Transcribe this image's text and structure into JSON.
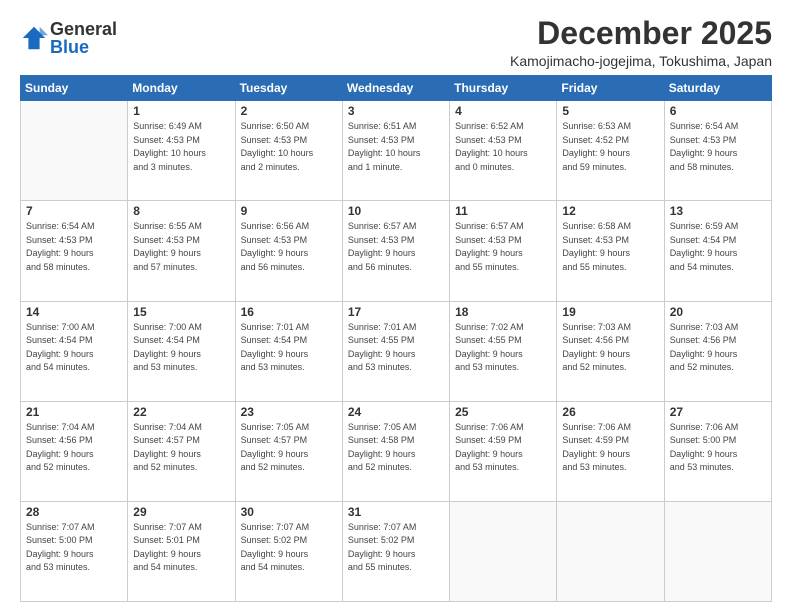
{
  "logo": {
    "line1": "General",
    "line2": "Blue"
  },
  "title": "December 2025",
  "subtitle": "Kamojimacho-jogejima, Tokushima, Japan",
  "days_of_week": [
    "Sunday",
    "Monday",
    "Tuesday",
    "Wednesday",
    "Thursday",
    "Friday",
    "Saturday"
  ],
  "weeks": [
    [
      {
        "day": "",
        "info": ""
      },
      {
        "day": "1",
        "info": "Sunrise: 6:49 AM\nSunset: 4:53 PM\nDaylight: 10 hours\nand 3 minutes."
      },
      {
        "day": "2",
        "info": "Sunrise: 6:50 AM\nSunset: 4:53 PM\nDaylight: 10 hours\nand 2 minutes."
      },
      {
        "day": "3",
        "info": "Sunrise: 6:51 AM\nSunset: 4:53 PM\nDaylight: 10 hours\nand 1 minute."
      },
      {
        "day": "4",
        "info": "Sunrise: 6:52 AM\nSunset: 4:53 PM\nDaylight: 10 hours\nand 0 minutes."
      },
      {
        "day": "5",
        "info": "Sunrise: 6:53 AM\nSunset: 4:52 PM\nDaylight: 9 hours\nand 59 minutes."
      },
      {
        "day": "6",
        "info": "Sunrise: 6:54 AM\nSunset: 4:53 PM\nDaylight: 9 hours\nand 58 minutes."
      }
    ],
    [
      {
        "day": "7",
        "info": "Sunrise: 6:54 AM\nSunset: 4:53 PM\nDaylight: 9 hours\nand 58 minutes."
      },
      {
        "day": "8",
        "info": "Sunrise: 6:55 AM\nSunset: 4:53 PM\nDaylight: 9 hours\nand 57 minutes."
      },
      {
        "day": "9",
        "info": "Sunrise: 6:56 AM\nSunset: 4:53 PM\nDaylight: 9 hours\nand 56 minutes."
      },
      {
        "day": "10",
        "info": "Sunrise: 6:57 AM\nSunset: 4:53 PM\nDaylight: 9 hours\nand 56 minutes."
      },
      {
        "day": "11",
        "info": "Sunrise: 6:57 AM\nSunset: 4:53 PM\nDaylight: 9 hours\nand 55 minutes."
      },
      {
        "day": "12",
        "info": "Sunrise: 6:58 AM\nSunset: 4:53 PM\nDaylight: 9 hours\nand 55 minutes."
      },
      {
        "day": "13",
        "info": "Sunrise: 6:59 AM\nSunset: 4:54 PM\nDaylight: 9 hours\nand 54 minutes."
      }
    ],
    [
      {
        "day": "14",
        "info": "Sunrise: 7:00 AM\nSunset: 4:54 PM\nDaylight: 9 hours\nand 54 minutes."
      },
      {
        "day": "15",
        "info": "Sunrise: 7:00 AM\nSunset: 4:54 PM\nDaylight: 9 hours\nand 53 minutes."
      },
      {
        "day": "16",
        "info": "Sunrise: 7:01 AM\nSunset: 4:54 PM\nDaylight: 9 hours\nand 53 minutes."
      },
      {
        "day": "17",
        "info": "Sunrise: 7:01 AM\nSunset: 4:55 PM\nDaylight: 9 hours\nand 53 minutes."
      },
      {
        "day": "18",
        "info": "Sunrise: 7:02 AM\nSunset: 4:55 PM\nDaylight: 9 hours\nand 53 minutes."
      },
      {
        "day": "19",
        "info": "Sunrise: 7:03 AM\nSunset: 4:56 PM\nDaylight: 9 hours\nand 52 minutes."
      },
      {
        "day": "20",
        "info": "Sunrise: 7:03 AM\nSunset: 4:56 PM\nDaylight: 9 hours\nand 52 minutes."
      }
    ],
    [
      {
        "day": "21",
        "info": "Sunrise: 7:04 AM\nSunset: 4:56 PM\nDaylight: 9 hours\nand 52 minutes."
      },
      {
        "day": "22",
        "info": "Sunrise: 7:04 AM\nSunset: 4:57 PM\nDaylight: 9 hours\nand 52 minutes."
      },
      {
        "day": "23",
        "info": "Sunrise: 7:05 AM\nSunset: 4:57 PM\nDaylight: 9 hours\nand 52 minutes."
      },
      {
        "day": "24",
        "info": "Sunrise: 7:05 AM\nSunset: 4:58 PM\nDaylight: 9 hours\nand 52 minutes."
      },
      {
        "day": "25",
        "info": "Sunrise: 7:06 AM\nSunset: 4:59 PM\nDaylight: 9 hours\nand 53 minutes."
      },
      {
        "day": "26",
        "info": "Sunrise: 7:06 AM\nSunset: 4:59 PM\nDaylight: 9 hours\nand 53 minutes."
      },
      {
        "day": "27",
        "info": "Sunrise: 7:06 AM\nSunset: 5:00 PM\nDaylight: 9 hours\nand 53 minutes."
      }
    ],
    [
      {
        "day": "28",
        "info": "Sunrise: 7:07 AM\nSunset: 5:00 PM\nDaylight: 9 hours\nand 53 minutes."
      },
      {
        "day": "29",
        "info": "Sunrise: 7:07 AM\nSunset: 5:01 PM\nDaylight: 9 hours\nand 54 minutes."
      },
      {
        "day": "30",
        "info": "Sunrise: 7:07 AM\nSunset: 5:02 PM\nDaylight: 9 hours\nand 54 minutes."
      },
      {
        "day": "31",
        "info": "Sunrise: 7:07 AM\nSunset: 5:02 PM\nDaylight: 9 hours\nand 55 minutes."
      },
      {
        "day": "",
        "info": ""
      },
      {
        "day": "",
        "info": ""
      },
      {
        "day": "",
        "info": ""
      }
    ]
  ]
}
